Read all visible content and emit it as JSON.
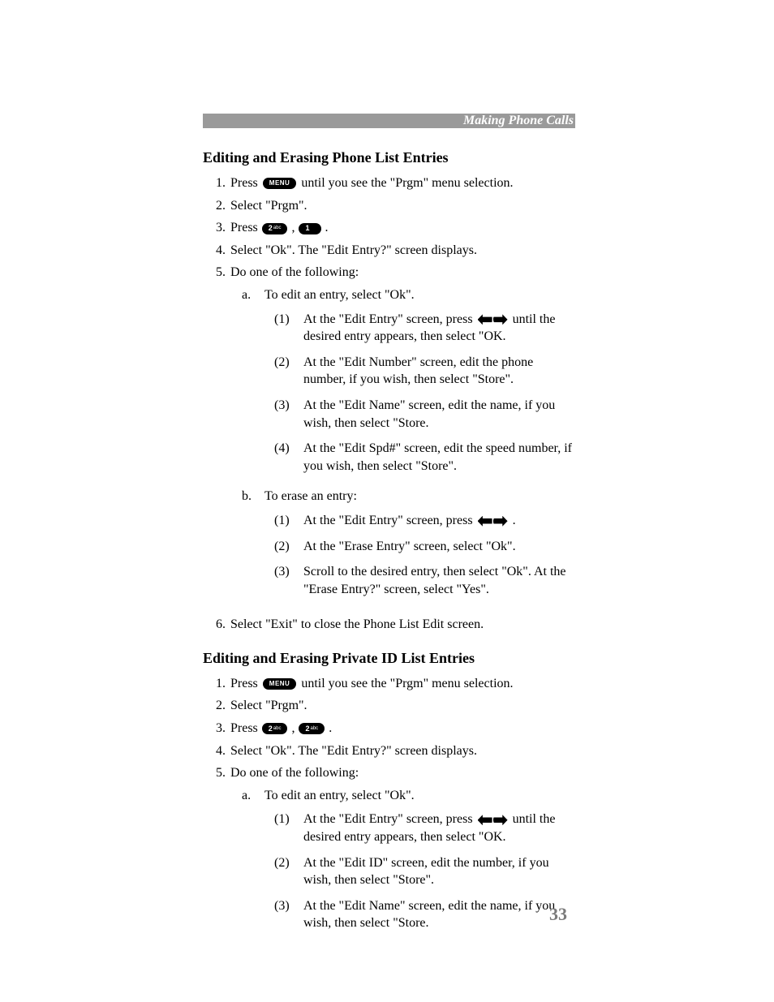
{
  "header": {
    "section": "Making Phone Calls"
  },
  "pageNumber": "33",
  "s1": {
    "title": "Editing and Erasing Phone List Entries",
    "step1a": "Press ",
    "step1b": " until you see the \"Prgm\" menu selection.",
    "step2": "Select \"Prgm\".",
    "step3a": "Press ",
    "step3b": ", ",
    "step3c": ".",
    "step4": "Select \"Ok\". The \"Edit Entry?\" screen displays.",
    "step5": "Do one of the following:",
    "aLead": "To edit an entry, select \"Ok\".",
    "a1a": "At the \"Edit Entry\" screen, press ",
    "a1b": " until the desired entry appears, then select \"OK.",
    "a2": "At the \"Edit Number\" screen, edit the phone number, if you wish, then select \"Store\".",
    "a3": "At the \"Edit Name\" screen, edit the name, if you wish, then select \"Store.",
    "a4": "At the \"Edit Spd#\" screen, edit the speed number, if you wish, then select \"Store\".",
    "bLead": "To erase an entry:",
    "b1a": "At the \"Edit Entry\" screen, press ",
    "b1b": ".",
    "b2": "At the \"Erase Entry\" screen, select \"Ok\".",
    "b3": "Scroll to the desired entry, then select \"Ok\". At the \"Erase Entry?\" screen, select \"Yes\".",
    "step6": "Select \"Exit\" to close the Phone List Edit screen."
  },
  "s2": {
    "title": "Editing and Erasing Private ID List Entries",
    "step1a": "Press ",
    "step1b": " until you see the \"Prgm\" menu selection.",
    "step2": "Select \"Prgm\".",
    "step3a": "Press ",
    "step3b": ", ",
    "step3c": ".",
    "step4": "Select \"Ok\". The \"Edit Entry?\" screen displays.",
    "step5": "Do one of the following:",
    "aLead": "To edit an entry, select \"Ok\".",
    "a1a": "At the \"Edit Entry\" screen, press ",
    "a1b": " until the desired entry appears, then select \"OK.",
    "a2": "At the \"Edit ID\" screen, edit the number, if you wish, then select \"Store\".",
    "a3": "At the \"Edit Name\" screen, edit the name, if you wish, then select \"Store."
  },
  "icons": {
    "menu": "MENU",
    "key2": "2",
    "key2sub": "abc",
    "key1": "1"
  }
}
